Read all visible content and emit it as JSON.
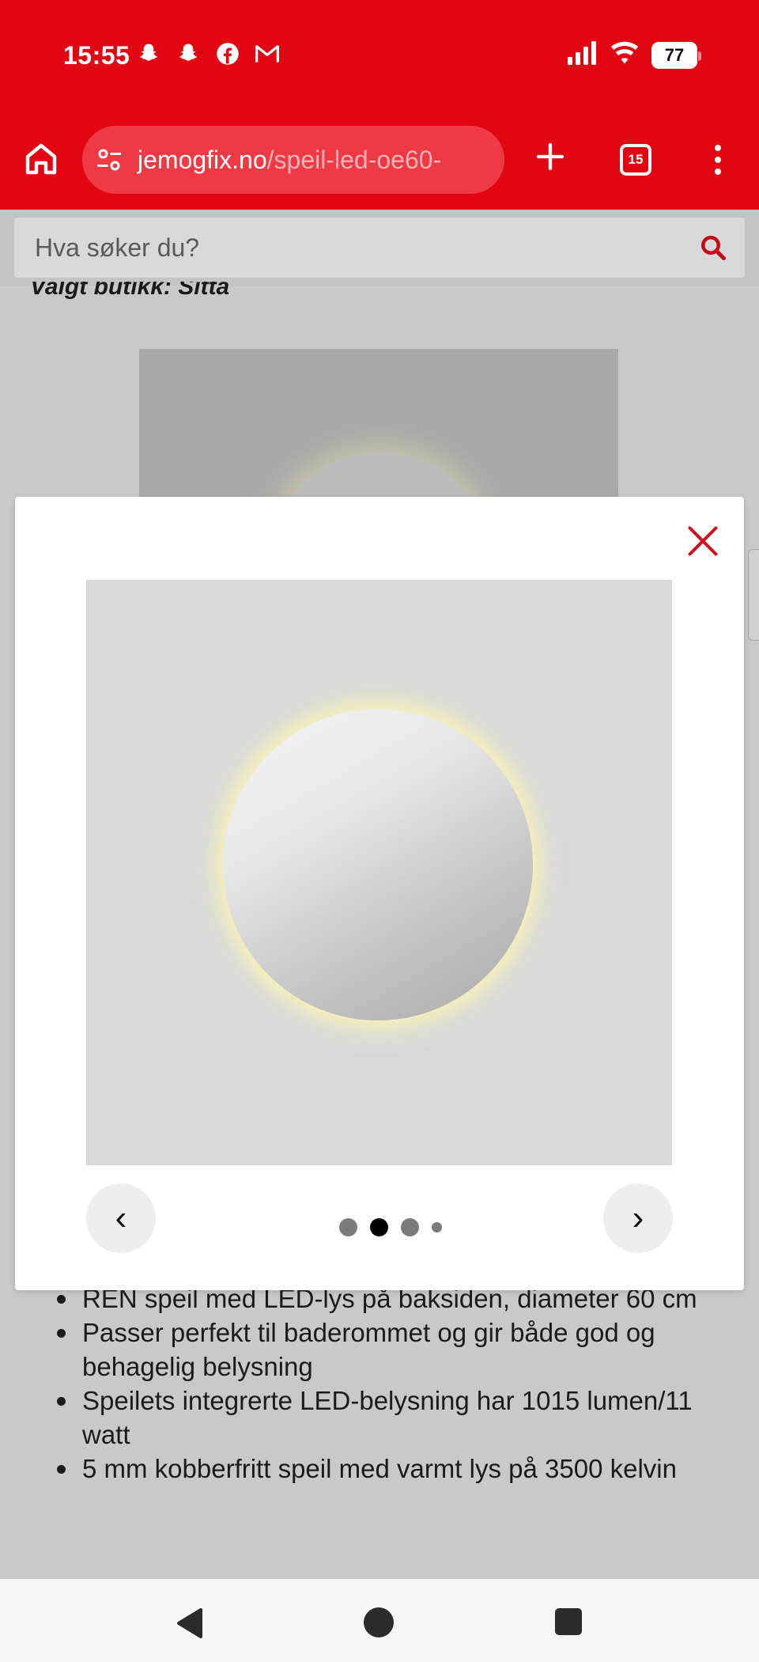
{
  "status_bar": {
    "time": "15:55",
    "battery": "77",
    "notifications": [
      "snapchat-icon",
      "snapchat-icon",
      "facebook-icon",
      "gmail-icon"
    ],
    "system": [
      "signal-icon",
      "wifi-icon",
      "battery-icon"
    ]
  },
  "browser": {
    "url_host": "jemogfix.no",
    "url_path": "/speil-led-oe60-",
    "tab_count": "15"
  },
  "search": {
    "placeholder": "Hva søker du?"
  },
  "page": {
    "store_label": "Valgt butikk: Sitta",
    "bullets": [
      "REN speil med LED-lys på baksiden, diameter 60 cm",
      "Passer perfekt til baderommet og gir både god og behagelig belysning",
      "Speilets integrerte LED-belysning har 1015 lumen/11 watt",
      "5 mm kobberfritt speil med varmt lys på 3500 kelvin"
    ]
  },
  "modal": {
    "prev_label": "‹",
    "next_label": "›",
    "image_count": 4,
    "active_index": 1
  },
  "colors": {
    "brand_red": "#e20613",
    "close_red": "#d0101c"
  }
}
